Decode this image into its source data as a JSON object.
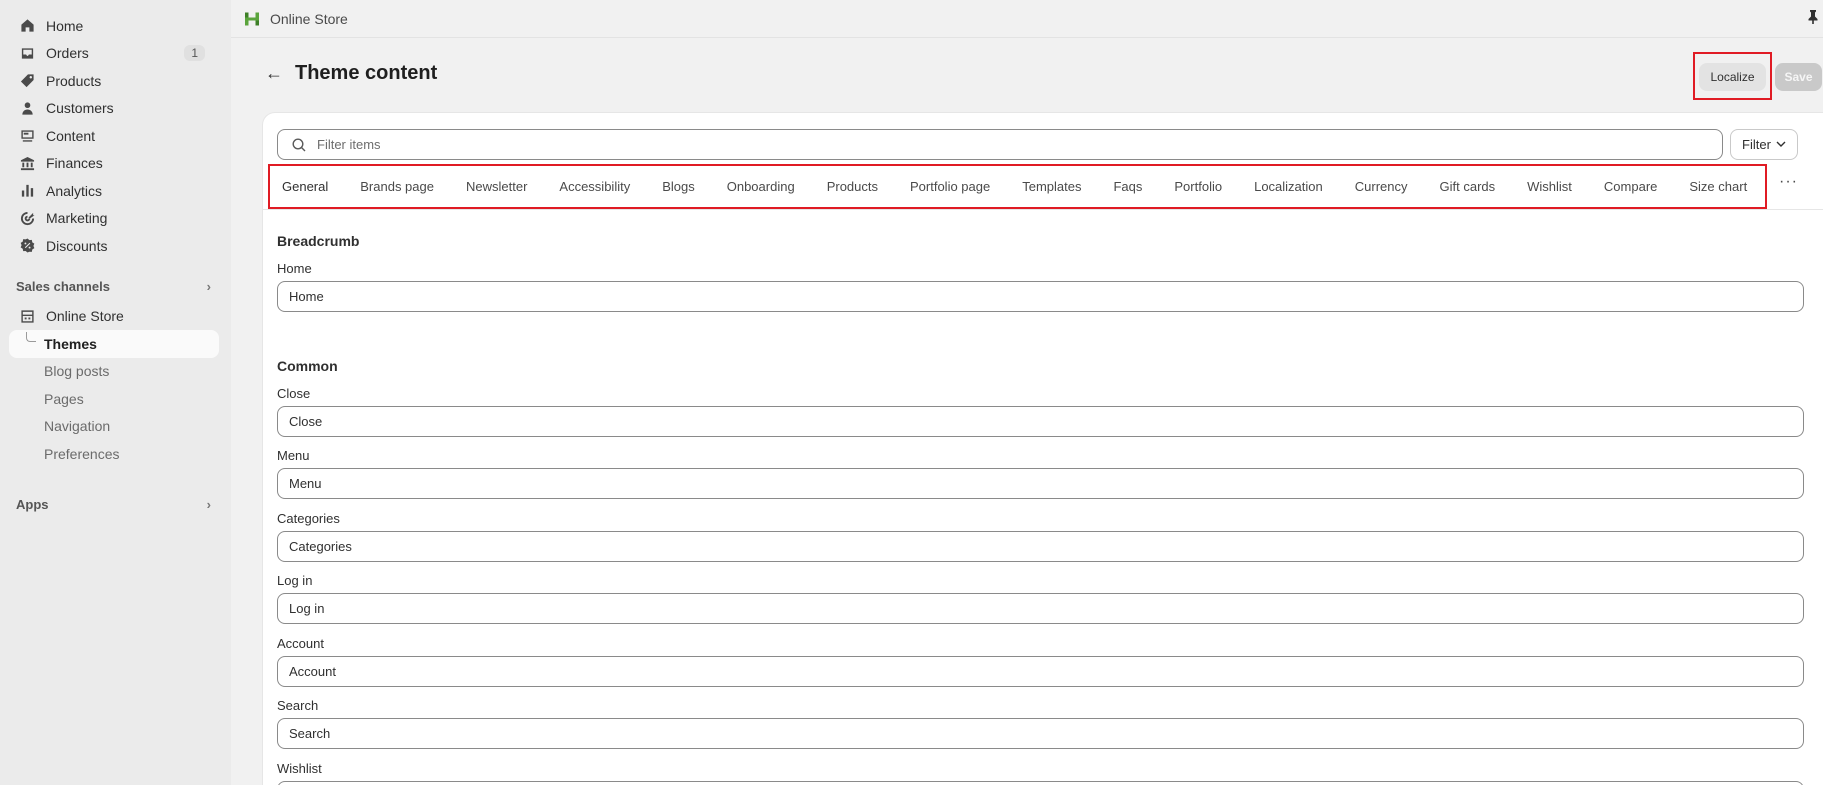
{
  "sidebar": {
    "items": [
      {
        "label": "Home",
        "icon": "home-icon"
      },
      {
        "label": "Orders",
        "icon": "inbox-icon",
        "badge": "1"
      },
      {
        "label": "Products",
        "icon": "tag-icon"
      },
      {
        "label": "Customers",
        "icon": "person-icon"
      },
      {
        "label": "Content",
        "icon": "content-icon"
      },
      {
        "label": "Finances",
        "icon": "bank-icon"
      },
      {
        "label": "Analytics",
        "icon": "bar-chart-icon"
      },
      {
        "label": "Marketing",
        "icon": "target-icon"
      },
      {
        "label": "Discounts",
        "icon": "discount-icon"
      }
    ],
    "sales_channels_label": "Sales channels",
    "online_store_label": "Online Store",
    "sub_items": [
      "Themes",
      "Blog posts",
      "Pages",
      "Navigation",
      "Preferences"
    ],
    "apps_label": "Apps"
  },
  "topbar": {
    "store_name": "Online Store"
  },
  "header": {
    "title": "Theme content",
    "localize_label": "Localize",
    "save_label": "Save"
  },
  "filter": {
    "placeholder": "Filter items",
    "button_label": "Filter"
  },
  "tabs": [
    "General",
    "Brands page",
    "Newsletter",
    "Accessibility",
    "Blogs",
    "Onboarding",
    "Products",
    "Portfolio page",
    "Templates",
    "Faqs",
    "Portfolio",
    "Localization",
    "Currency",
    "Gift cards",
    "Wishlist",
    "Compare",
    "Size chart"
  ],
  "sections": {
    "breadcrumb": {
      "title": "Breadcrumb",
      "fields": [
        {
          "label": "Home",
          "value": "Home"
        }
      ]
    },
    "common": {
      "title": "Common",
      "fields": [
        {
          "label": "Close",
          "value": "Close"
        },
        {
          "label": "Menu",
          "value": "Menu"
        },
        {
          "label": "Categories",
          "value": "Categories"
        },
        {
          "label": "Log in",
          "value": "Log in"
        },
        {
          "label": "Account",
          "value": "Account"
        },
        {
          "label": "Search",
          "value": "Search"
        },
        {
          "label": "Wishlist",
          "value": ""
        }
      ]
    }
  },
  "colors": {
    "highlight": "#e01b24",
    "sidebar_bg": "#ebebeb",
    "card_bg": "#ffffff"
  }
}
